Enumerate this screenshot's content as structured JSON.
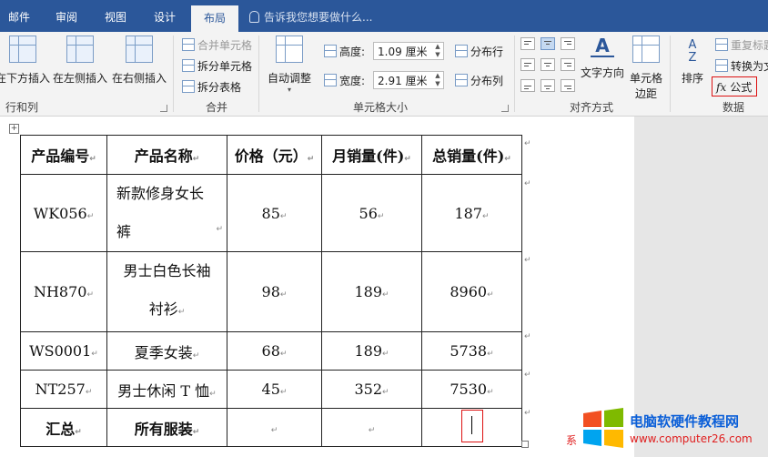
{
  "tabs": [
    {
      "label": "邮件"
    },
    {
      "label": "审阅"
    },
    {
      "label": "视图"
    },
    {
      "label": "设计"
    },
    {
      "label": "布局"
    }
  ],
  "tell_me": {
    "placeholder": "告诉我您想要做什么..."
  },
  "ribbon": {
    "rows_cols": {
      "insert_below": "在下方插入",
      "insert_left": "在左侧插入",
      "insert_right": "在右侧插入",
      "group_label": "行和列"
    },
    "merge": {
      "merge_cells": "合并单元格",
      "split_cells": "拆分单元格",
      "split_table": "拆分表格",
      "group_label": "合并"
    },
    "cell_size": {
      "autofit": "自动调整",
      "height_label": "高度:",
      "height_value": "1.09 厘米",
      "width_label": "宽度:",
      "width_value": "2.91 厘米",
      "distribute_rows": "分布行",
      "distribute_cols": "分布列",
      "group_label": "单元格大小"
    },
    "alignment": {
      "text_direction": "文字方向",
      "cell_margins_1": "单元格",
      "cell_margins_2": "边距",
      "group_label": "对齐方式"
    },
    "data": {
      "sort": "排序",
      "repeat_header": "重复标题",
      "convert_text": "转换为文",
      "formula": "公式",
      "group_label": "数据"
    }
  },
  "table": {
    "headers": [
      "产品编号",
      "产品名称",
      "价格（元）",
      "月销量(件)",
      "总销量(件)"
    ],
    "rows": [
      {
        "code": "WK056",
        "name": "新款修身女长",
        "name2": "裤",
        "price": "85",
        "monthly": "56",
        "total": "187"
      },
      {
        "code": "NH870",
        "name": "男士白色长袖",
        "name2": "衬衫",
        "price": "98",
        "monthly": "189",
        "total": "8960"
      },
      {
        "code": "WS0001",
        "name": "夏季女装",
        "name2": "",
        "price": "68",
        "monthly": "189",
        "total": "5738"
      },
      {
        "code": "NT257",
        "name": "男士休闲 T 恤",
        "name2": "",
        "price": "45",
        "monthly": "352",
        "total": "7530"
      }
    ],
    "summary": {
      "label": "汇总",
      "scope": "所有服装"
    }
  },
  "watermark": {
    "title": "电脑软硬件教程网",
    "url": "www.computer26.com",
    "left_text": "系"
  },
  "colors": {
    "accent": "#2b579a",
    "highlight": "#d11111"
  }
}
